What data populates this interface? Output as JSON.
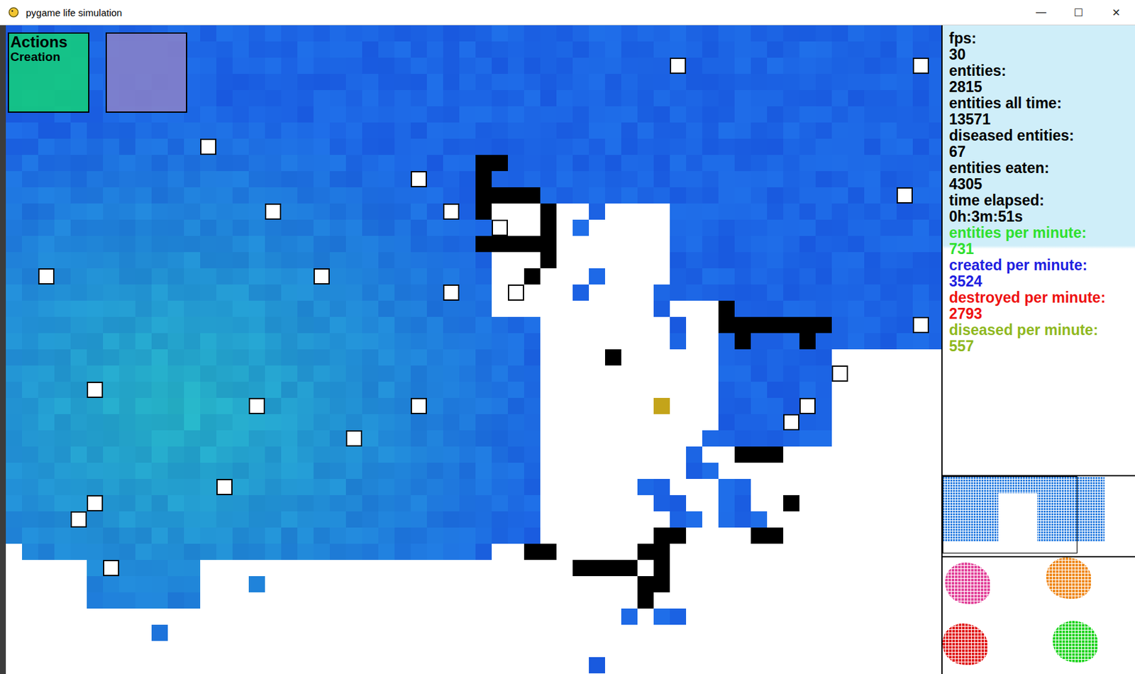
{
  "window": {
    "title": "pygame life simulation",
    "controls": [
      "—",
      "☐",
      "✕"
    ]
  },
  "overlay": {
    "actions": "Actions",
    "creation": "Creation"
  },
  "stats": [
    {
      "label": "fps:",
      "value": "30",
      "color": "#000000"
    },
    {
      "label": "entities:",
      "value": "2815",
      "color": "#000000"
    },
    {
      "label": "entities all time:",
      "value": "13571",
      "color": "#000000"
    },
    {
      "label": "diseased entities:",
      "value": "67",
      "color": "#000000"
    },
    {
      "label": "entities eaten:",
      "value": "4305",
      "color": "#000000"
    },
    {
      "label": "time elapsed:",
      "value": "0h:3m:51s",
      "color": "#000000"
    },
    {
      "label": "entities per minute:",
      "value": "731",
      "color": "#2ee02e"
    },
    {
      "label": "created per minute:",
      "value": "3524",
      "color": "#1f1fe0"
    },
    {
      "label": "destroyed per minute:",
      "value": "2793",
      "color": "#ee1111"
    },
    {
      "label": "diseased per minute:",
      "value": "557",
      "color": "#8fb81e"
    }
  ],
  "colonies": [
    {
      "color": "#e2449a"
    },
    {
      "color": "#ef8a1c"
    },
    {
      "color": "#e01818"
    },
    {
      "color": "#22d422"
    }
  ]
}
